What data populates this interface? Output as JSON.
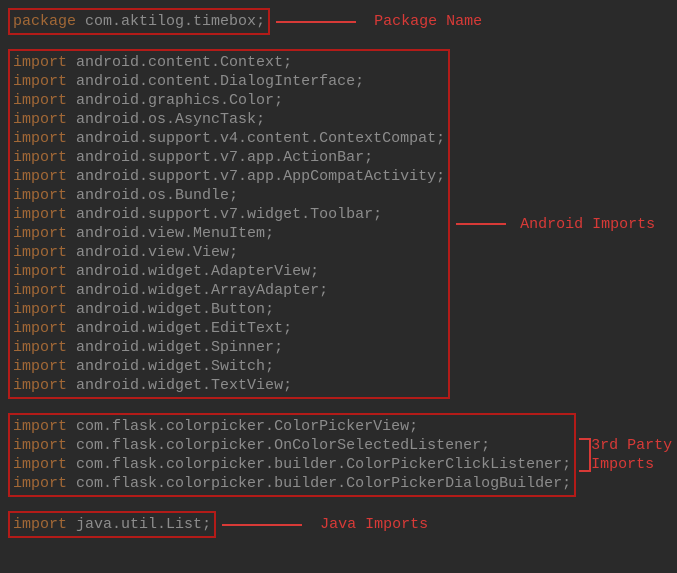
{
  "labels": {
    "package": "Package Name",
    "android": "Android Imports",
    "thirdparty1": "3rd Party",
    "thirdparty2": "Imports",
    "java": "Java Imports"
  },
  "pkg": {
    "kw": "package",
    "name": "com.aktilog.timebox"
  },
  "android_imports": [
    {
      "kw": "import",
      "name": "android.content.Context"
    },
    {
      "kw": "import",
      "name": "android.content.DialogInterface"
    },
    {
      "kw": "import",
      "name": "android.graphics.Color"
    },
    {
      "kw": "import",
      "name": "android.os.AsyncTask"
    },
    {
      "kw": "import",
      "name": "android.support.v4.content.ContextCompat"
    },
    {
      "kw": "import",
      "name": "android.support.v7.app.ActionBar"
    },
    {
      "kw": "import",
      "name": "android.support.v7.app.AppCompatActivity"
    },
    {
      "kw": "import",
      "name": "android.os.Bundle"
    },
    {
      "kw": "import",
      "name": "android.support.v7.widget.Toolbar"
    },
    {
      "kw": "import",
      "name": "android.view.MenuItem"
    },
    {
      "kw": "import",
      "name": "android.view.View"
    },
    {
      "kw": "import",
      "name": "android.widget.AdapterView"
    },
    {
      "kw": "import",
      "name": "android.widget.ArrayAdapter"
    },
    {
      "kw": "import",
      "name": "android.widget.Button"
    },
    {
      "kw": "import",
      "name": "android.widget.EditText"
    },
    {
      "kw": "import",
      "name": "android.widget.Spinner"
    },
    {
      "kw": "import",
      "name": "android.widget.Switch"
    },
    {
      "kw": "import",
      "name": "android.widget.TextView"
    }
  ],
  "thirdparty_imports": [
    {
      "kw": "import",
      "name": "com.flask.colorpicker.ColorPickerView"
    },
    {
      "kw": "import",
      "name": "com.flask.colorpicker.OnColorSelectedListener"
    },
    {
      "kw": "import",
      "name": "com.flask.colorpicker.builder.ColorPickerClickListener"
    },
    {
      "kw": "import",
      "name": "com.flask.colorpicker.builder.ColorPickerDialogBuilder"
    }
  ],
  "java_imports": [
    {
      "kw": "import",
      "name": "java.util.List"
    }
  ]
}
